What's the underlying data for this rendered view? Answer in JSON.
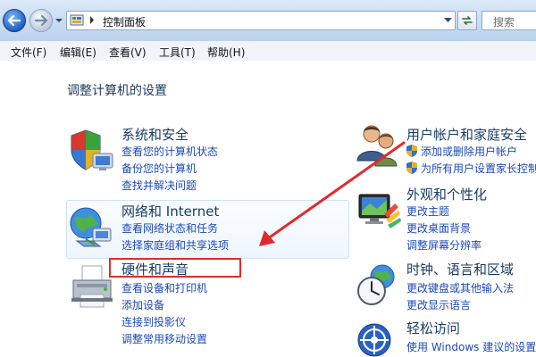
{
  "nav": {
    "back": "back-button",
    "forward": "forward-button",
    "breadcrumb": [
      "控制面板"
    ],
    "search_placeholder": "搜索"
  },
  "menu": [
    "文件(F)",
    "编辑(E)",
    "查看(V)",
    "工具(T)",
    "帮助(H)"
  ],
  "page_title": "调整计算机的设置",
  "categories_left": [
    {
      "title": "系统和安全",
      "icon": "shield-flag-icon",
      "links": [
        "查看您的计算机状态",
        "备份您的计算机",
        "查找并解决问题"
      ]
    },
    {
      "title": "网络和 Internet",
      "icon": "network-globe-icon",
      "links": [
        "查看网络状态和任务",
        "选择家庭组和共享选项"
      ]
    },
    {
      "title": "硬件和声音",
      "icon": "printer-icon",
      "links": [
        "查看设备和打印机",
        "添加设备",
        "连接到投影仪",
        "调整常用移动设置"
      ]
    }
  ],
  "categories_right": [
    {
      "title": "用户帐户和家庭安全",
      "icon": "users-icon",
      "links": [
        "添加或删除用户帐户",
        "为所有用户设置家长控制"
      ],
      "shielded": true
    },
    {
      "title": "外观和个性化",
      "icon": "monitor-palette-icon",
      "links": [
        "更改主题",
        "更改桌面背景",
        "调整屏幕分辨率"
      ]
    },
    {
      "title": "时钟、语言和区域",
      "icon": "clock-globe-icon",
      "links": [
        "更改键盘或其他输入法",
        "更改显示语言"
      ]
    },
    {
      "title": "轻松访问",
      "icon": "ease-of-access-icon",
      "links": [
        "使用 Windows 建议的设置"
      ]
    }
  ],
  "colors": {
    "link": "#1c49b8",
    "category_title": "#1a3c66",
    "annotation_red": "#e12b2b"
  }
}
